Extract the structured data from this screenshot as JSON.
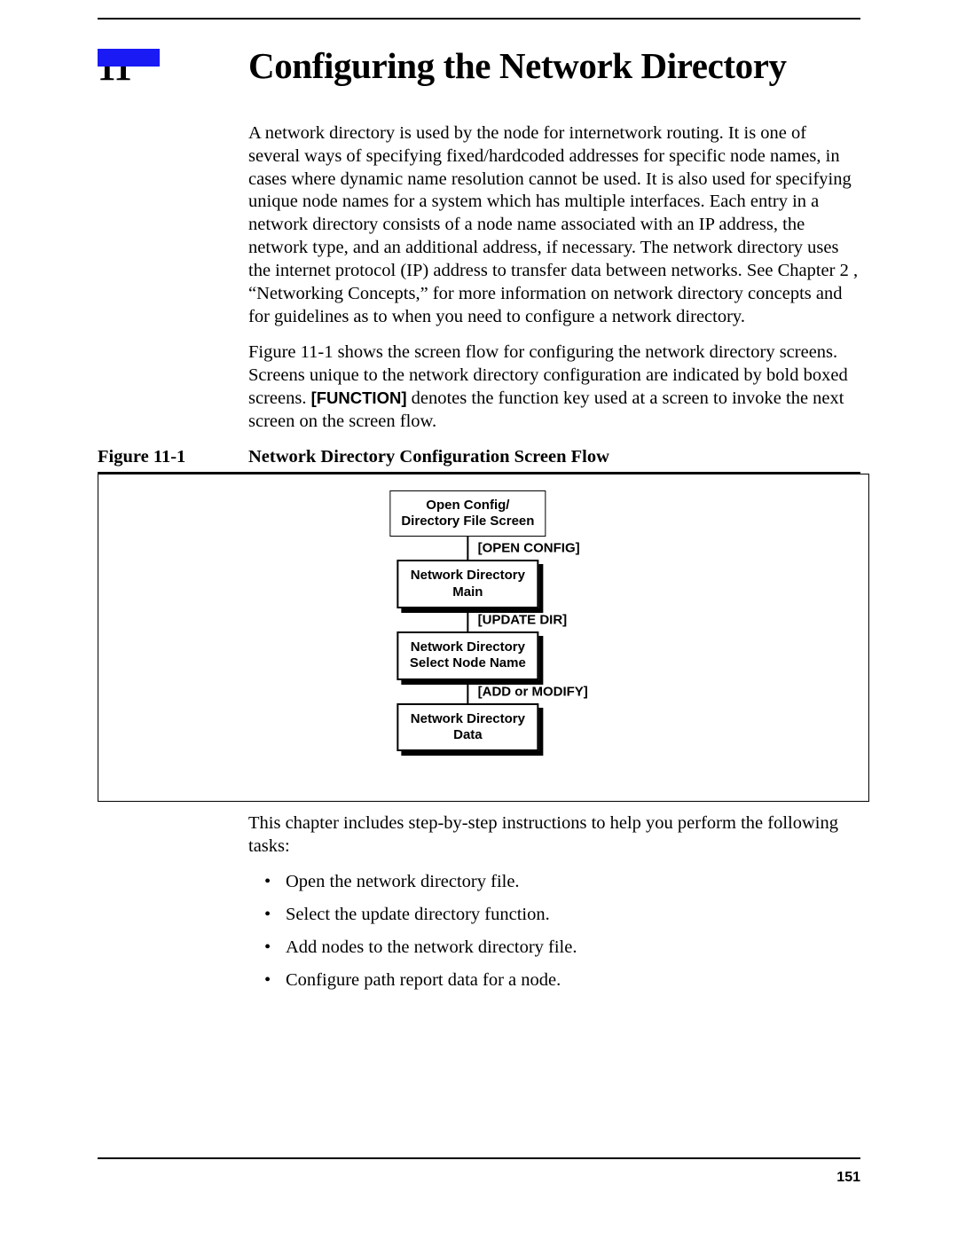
{
  "chapter_number": "11",
  "chapter_title": "Configuring the Network Directory",
  "para1": "A network directory is used by the node for internetwork routing. It is one of several ways of specifying fixed/hardcoded addresses for specific node names, in cases where dynamic name resolution cannot be used. It is also used for specifying unique node names for a system which has multiple interfaces. Each entry in a network directory consists of a node name associated with an IP address, the network type, and an additional address, if necessary. The network directory uses the internet protocol (IP) address to transfer data between networks. See Chapter 2 , “Networking Concepts,” for more information on network directory concepts and for guidelines as to when you need to configure a network directory.",
  "para2_pre": "Figure 11-1 shows the screen flow for configuring the network directory screens. Screens unique to the network directory configuration are indicated by bold boxed screens. ",
  "para2_fn": "[FUNCTION]",
  "para2_post": " denotes the function key used at a screen to invoke the next screen on the screen flow.",
  "figure_label": "Figure 11-1",
  "figure_caption": "Network Directory Configuration Screen Flow",
  "flow": {
    "box1_line1": "Open Config/",
    "box1_line2": "Directory File Screen",
    "conn1": "[OPEN CONFIG]",
    "box2_line1": "Network Directory",
    "box2_line2": "Main",
    "conn2": "[UPDATE DIR]",
    "box3_line1": "Network Directory",
    "box3_line2": "Select Node Name",
    "conn3": "[ADD or MODIFY]",
    "box4_line1": "Network Directory",
    "box4_line2": "Data"
  },
  "para3": "This chapter includes step-by-step instructions to help you perform the following tasks:",
  "tasks": [
    "Open the network directory file.",
    "Select the update directory function.",
    "Add nodes to the network directory file.",
    "Configure path report data for a node."
  ],
  "page_number": "151"
}
